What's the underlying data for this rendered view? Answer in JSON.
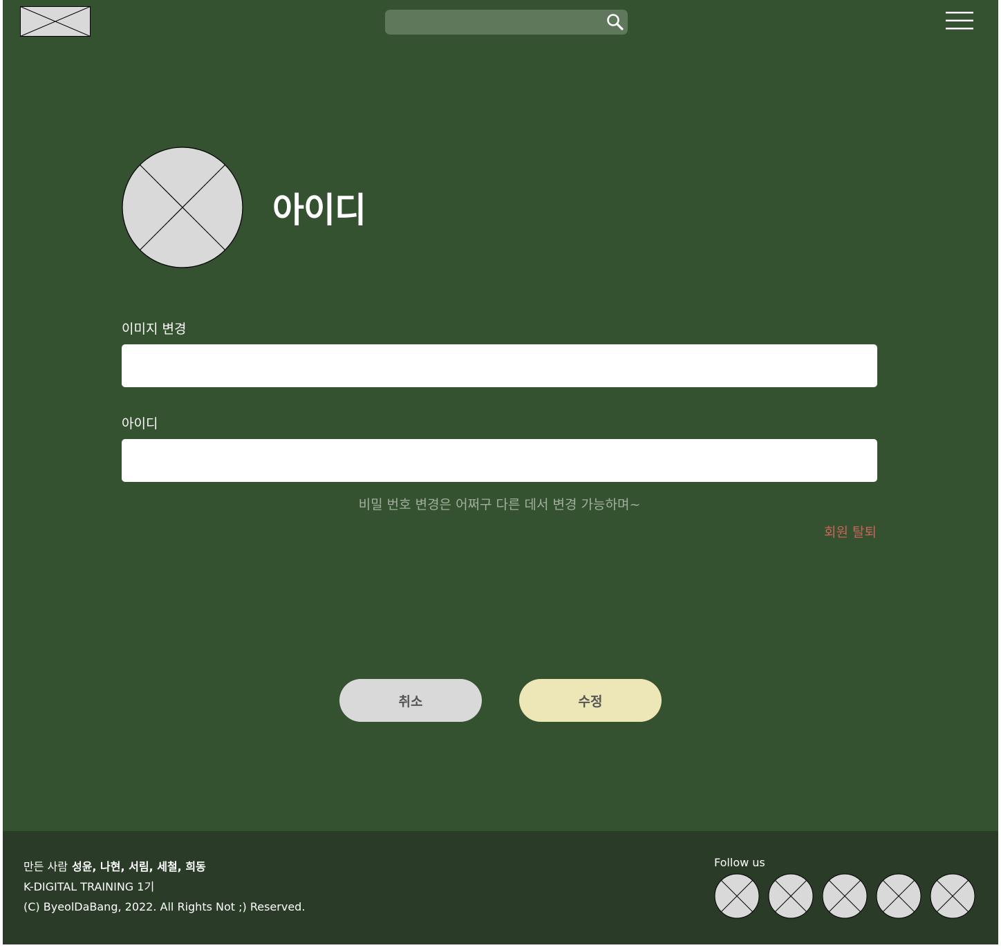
{
  "header": {
    "logo_icon": "image-placeholder-icon",
    "search_placeholder": "",
    "search_icon": "search-icon",
    "menu_icon": "hamburger-menu-icon"
  },
  "profile": {
    "avatar_icon": "image-placeholder-icon",
    "name": "아이디"
  },
  "form": {
    "image_label": "이미지 변경",
    "image_value": "",
    "id_label": "아이디",
    "id_value": "",
    "password_note": "비밀 번호 변경은 어쩌구 다른 데서 변경 가능하며~",
    "withdraw_label": "회원 탈퇴"
  },
  "actions": {
    "cancel_label": "취소",
    "edit_label": "수정"
  },
  "footer": {
    "makers_label": "만든 사람",
    "makers_names": "성윤, 나현, 서림, 세철, 희동",
    "program": "K-DIGITAL TRAINING 1기",
    "copyright": "(C) ByeolDaBang, 2022. All Rights Not ;) Reserved.",
    "follow_label": "Follow us",
    "social_icons": [
      "image-placeholder-icon",
      "image-placeholder-icon",
      "image-placeholder-icon",
      "image-placeholder-icon",
      "image-placeholder-icon"
    ]
  },
  "colors": {
    "background": "#345130",
    "footer": "#2a3c28",
    "search_bg": "#5f775b",
    "cancel_bg": "#d9d9d9",
    "edit_bg": "#ede6b7",
    "withdraw_text": "#c8655b",
    "note_text": "#a3ae9f"
  }
}
